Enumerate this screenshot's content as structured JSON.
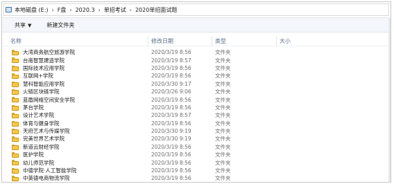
{
  "breadcrumb": {
    "items": [
      "本地磁盘 (E:)",
      "F盘",
      "2020.3",
      "单招考试",
      "2020单招面试题"
    ],
    "separator": "›"
  },
  "toolbar": {
    "share_label": "共享",
    "new_folder_label": "新建文件夹"
  },
  "columns": {
    "name": "名称",
    "date": "修改日期",
    "type": "类型",
    "size": "大小"
  },
  "files": [
    {
      "name": "大湾商务航空旅游学院",
      "date": "2020/3/19 8:56",
      "type": "文件夹"
    },
    {
      "name": "台南智慧建造学院",
      "date": "2020/3/19 8:57",
      "type": "文件夹"
    },
    {
      "name": "国际技术应用学院",
      "date": "2020/3/19 8:56",
      "type": "文件夹"
    },
    {
      "name": "互联网+学院",
      "date": "2020/3/19 8:56",
      "type": "文件夹"
    },
    {
      "name": "慧科智能应用学院",
      "date": "2020/3/30 9:17",
      "type": "文件夹"
    },
    {
      "name": "火链区块链学院",
      "date": "2020/3/26 9:06",
      "type": "文件夹"
    },
    {
      "name": "蓝盾网络空间安全学院",
      "date": "2020/3/19 8:56",
      "type": "文件夹"
    },
    {
      "name": "茅台学院",
      "date": "2020/3/19 8:56",
      "type": "文件夹"
    },
    {
      "name": "设计艺术学院",
      "date": "2020/3/19 8:57",
      "type": "文件夹"
    },
    {
      "name": "体育与健身学院",
      "date": "2020/3/19 8:56",
      "type": "文件夹"
    },
    {
      "name": "天府艺术与传媒学院",
      "date": "2020/3/30 9:19",
      "type": "文件夹"
    },
    {
      "name": "完美世界艺术学院",
      "date": "2020/3/30 9:19",
      "type": "文件夹"
    },
    {
      "name": "新道云财经学院",
      "date": "2020/3/19 8:56",
      "type": "文件夹"
    },
    {
      "name": "医护学院",
      "date": "2020/3/19 8:56",
      "type": "文件夹"
    },
    {
      "name": "幼儿师范学院",
      "date": "2020/3/19 8:56",
      "type": "文件夹"
    },
    {
      "name": "中德学院·人工智能学院",
      "date": "2020/3/19 8:56",
      "type": "文件夹"
    },
    {
      "name": "中英德电商物流学院",
      "date": "2020/3/19 8:56",
      "type": "文件夹"
    }
  ],
  "icons": {
    "drive": "drive-icon",
    "folder": "folder-icon",
    "dropdown": "chevron-down-icon"
  },
  "colors": {
    "folder_fill": "#f2c94c",
    "header_text": "#5a6b86",
    "command_bar_bg": "#f3f6fb"
  }
}
